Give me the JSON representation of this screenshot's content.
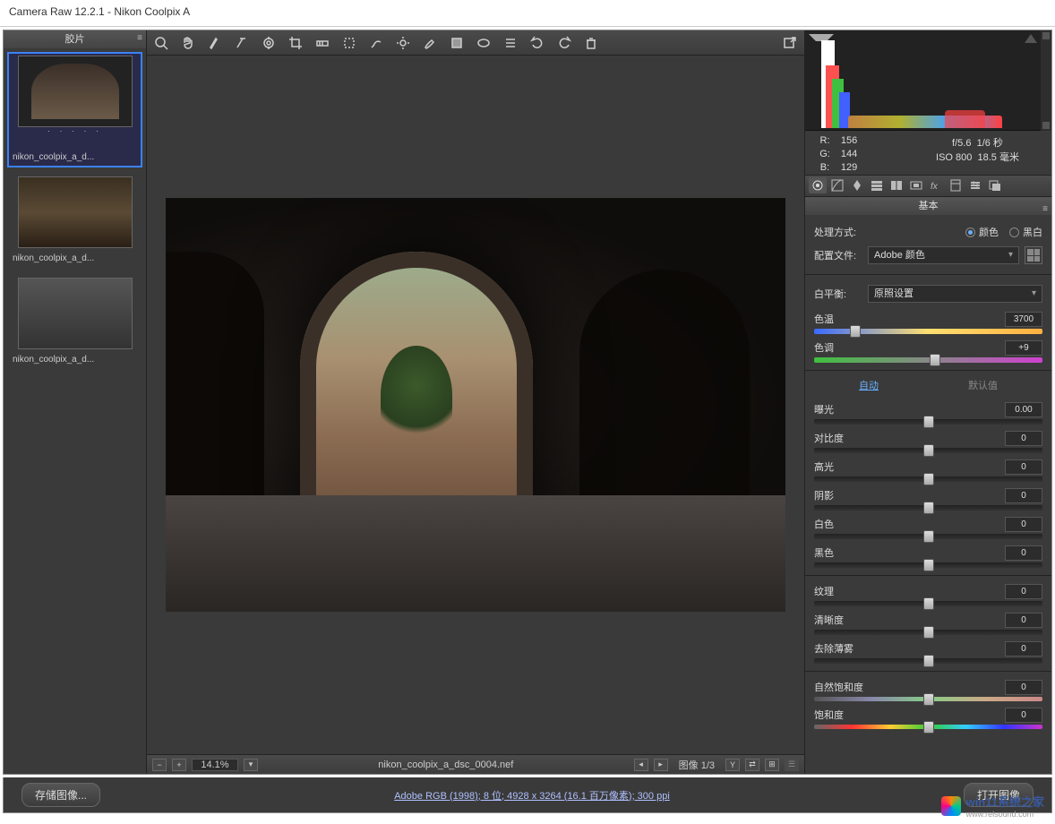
{
  "title": "Camera Raw 12.2.1  -  Nikon Coolpix A",
  "filmstrip": {
    "header": "胶片",
    "items": [
      {
        "label": "nikon_coolpix_a_d...",
        "selected": true
      },
      {
        "label": "nikon_coolpix_a_d...",
        "selected": false
      },
      {
        "label": "nikon_coolpix_a_d...",
        "selected": false
      }
    ]
  },
  "status": {
    "zoom": "14.1%",
    "filename": "nikon_coolpix_a_dsc_0004.nef",
    "index": "图像 1/3"
  },
  "readout": {
    "r": "156",
    "g": "144",
    "b": "129",
    "aperture": "f/5.6",
    "shutter": "1/6 秒",
    "iso": "ISO 800",
    "focal": "18.5 毫米"
  },
  "basic": {
    "panel_title": "基本",
    "treatment_label": "处理方式:",
    "treatment_color": "颜色",
    "treatment_bw": "黑白",
    "profile_label": "配置文件:",
    "profile_value": "Adobe 颜色",
    "wb_label": "白平衡:",
    "wb_value": "原照设置",
    "temp_label": "色温",
    "temp_value": "3700",
    "tint_label": "色调",
    "tint_value": "+9",
    "auto_label": "自动",
    "default_label": "默认值",
    "exposure_label": "曝光",
    "exposure_value": "0.00",
    "contrast_label": "对比度",
    "contrast_value": "0",
    "highlights_label": "高光",
    "highlights_value": "0",
    "shadows_label": "阴影",
    "shadows_value": "0",
    "whites_label": "白色",
    "whites_value": "0",
    "blacks_label": "黑色",
    "blacks_value": "0",
    "texture_label": "纹理",
    "texture_value": "0",
    "clarity_label": "清晰度",
    "clarity_value": "0",
    "dehaze_label": "去除薄雾",
    "dehaze_value": "0",
    "vibrance_label": "自然饱和度",
    "vibrance_value": "0",
    "saturation_label": "饱和度",
    "saturation_value": "0"
  },
  "footer": {
    "save": "存储图像...",
    "meta": "Adobe RGB (1998); 8 位; 4928 x 3264 (16.1 百万像素); 300 ppi",
    "open": "打开图像"
  },
  "watermark": {
    "brand": "win11系统之家",
    "url": "www.relsound.com"
  }
}
